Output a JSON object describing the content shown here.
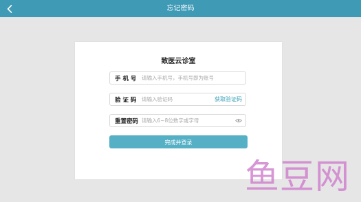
{
  "header": {
    "title": "忘记密码",
    "back_icon": "chevron-left-icon"
  },
  "form": {
    "title": "致医云诊室",
    "phone": {
      "label": "手 机 号",
      "placeholder": "请输入手机号，手机号即为账号"
    },
    "code": {
      "label": "验 证 码",
      "placeholder": "请输入验证码",
      "action": "获取验证码"
    },
    "password": {
      "label": "重置密码",
      "placeholder": "请输入6~8位数字或字母",
      "eye_icon": "eye-icon"
    },
    "submit": "完成并登录"
  },
  "watermark": {
    "text": "鱼豆网"
  },
  "colors": {
    "header_bg": "#3f9ab6",
    "button_bg": "#55b0c6",
    "link": "#3aa1b8",
    "background": "#e6e6e6"
  }
}
